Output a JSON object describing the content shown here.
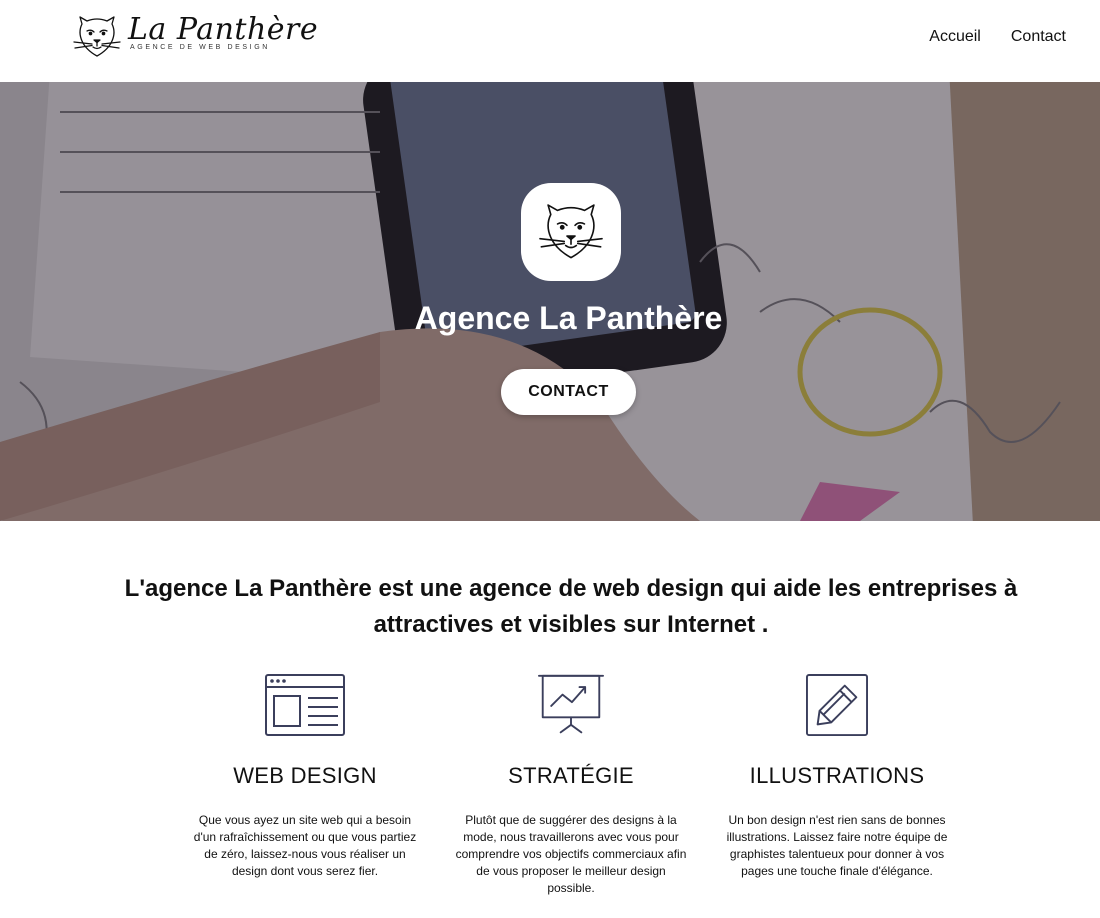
{
  "brand": {
    "title": "La Panthère",
    "subtitle": "AGENCE DE WEB DESIGN"
  },
  "nav": {
    "items": [
      {
        "label": "Accueil"
      },
      {
        "label": "Contact"
      }
    ]
  },
  "hero": {
    "title": "Agence La Panthère",
    "button_label": "CONTACT"
  },
  "intro": {
    "text": "L'agence La Panthère est une agence de web design qui aide les entreprises à attractives et visibles sur Internet ."
  },
  "features": [
    {
      "icon": "browser-window-icon",
      "title": "WEB DESIGN",
      "text": "Que vous ayez un site web qui a besoin d'un rafraîchissement ou que vous partiez de zéro, laissez-nous vous réaliser un design dont vous serez fier."
    },
    {
      "icon": "presentation-chart-icon",
      "title": "STRATÉGIE",
      "text": "Plutôt que de suggérer des designs à la mode, nous travaillerons avec vous pour comprendre vos objectifs commerciaux afin de vous proposer le meilleur design possible."
    },
    {
      "icon": "pencil-icon",
      "title": "ILLUSTRATIONS",
      "text": "Un bon design n'est rien sans de bonnes illustrations. Laissez faire notre équipe de graphistes talentueux pour donner à vos pages une touche finale d'élégance."
    }
  ],
  "colors": {
    "icon_stroke": "#3b3f5c",
    "header_bg": "#ffffff",
    "hero_overlay": "#1e1923",
    "text": "#111111"
  }
}
